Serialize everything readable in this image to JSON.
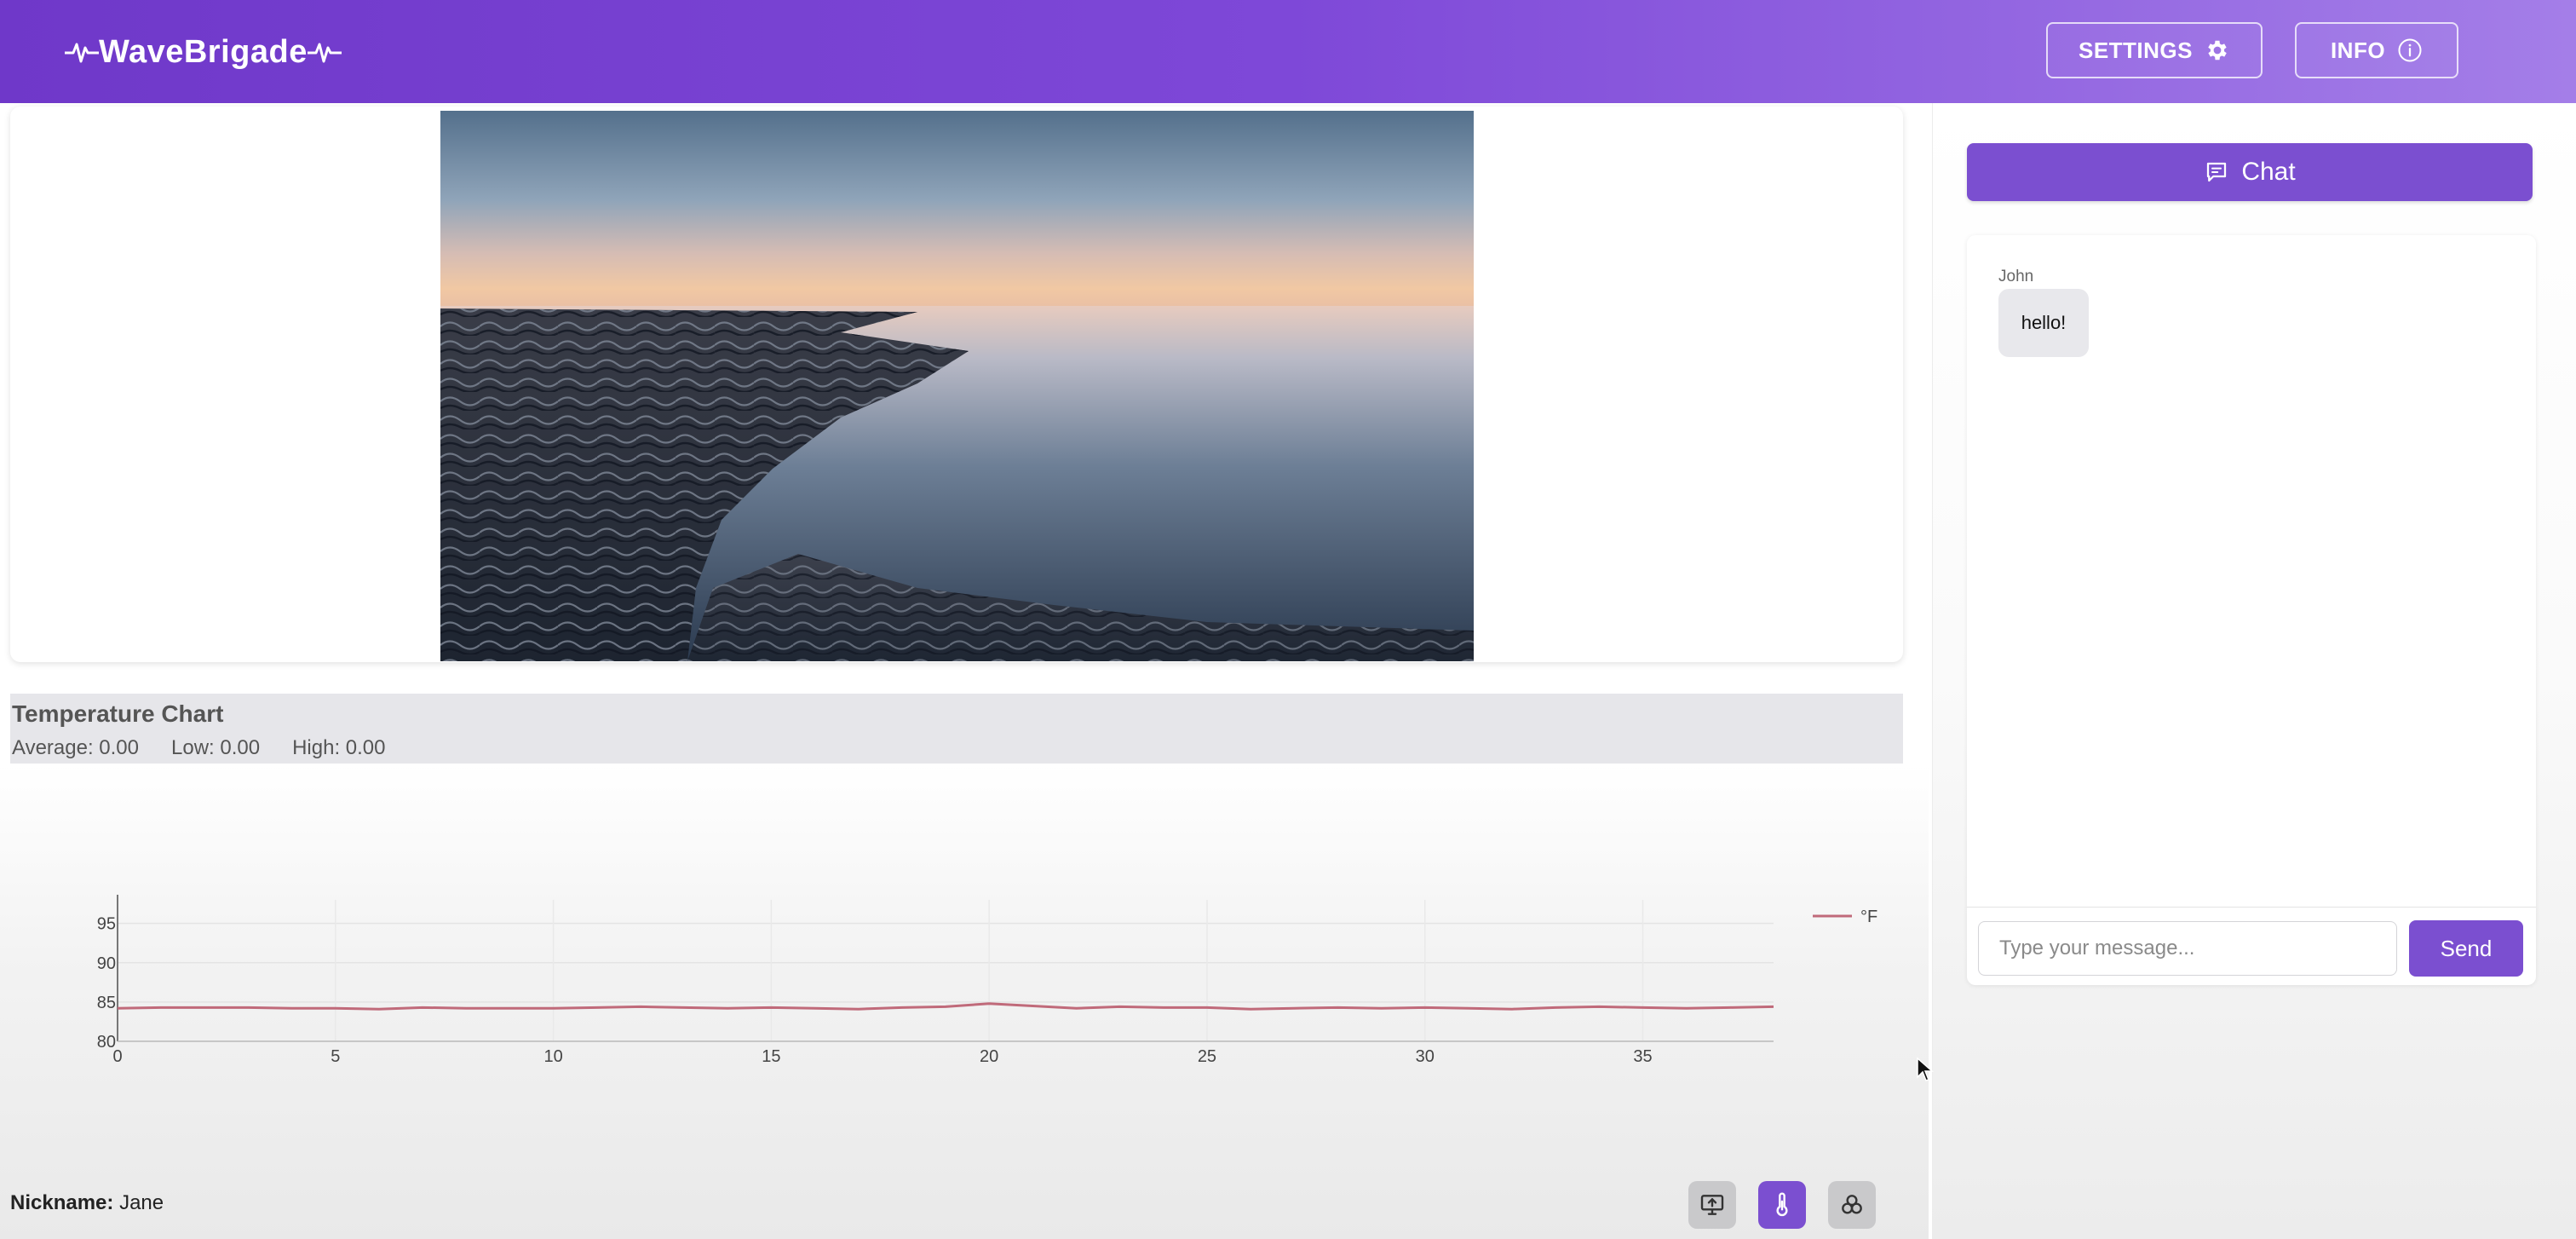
{
  "header": {
    "app_name": "WaveBrigade",
    "settings_label": "SETTINGS",
    "info_label": "INFO",
    "gradient_start": "#6f38c9",
    "gradient_end": "#a47ee8"
  },
  "temperature": {
    "title": "Temperature Chart",
    "average": "Average: 0.00",
    "low": "Low: 0.00",
    "high": "High: 0.00"
  },
  "chart_data": {
    "type": "line",
    "title": "",
    "xlabel": "",
    "ylabel": "",
    "xlim": [
      0,
      38
    ],
    "ylim": [
      80,
      98
    ],
    "x_ticks": [
      0,
      5,
      10,
      15,
      20,
      25,
      30,
      35
    ],
    "y_ticks": [
      80,
      85,
      90,
      95
    ],
    "grid": true,
    "legend_position": "top-right",
    "series": [
      {
        "name": "°F",
        "color": "#c06a7a",
        "x": [
          0,
          1,
          2,
          3,
          4,
          5,
          6,
          7,
          8,
          9,
          10,
          11,
          12,
          13,
          14,
          15,
          16,
          17,
          18,
          19,
          20,
          21,
          22,
          23,
          24,
          25,
          26,
          27,
          28,
          29,
          30,
          31,
          32,
          33,
          34,
          35,
          36,
          37,
          38
        ],
        "values": [
          84.2,
          84.3,
          84.3,
          84.3,
          84.2,
          84.2,
          84.1,
          84.3,
          84.2,
          84.2,
          84.2,
          84.3,
          84.4,
          84.3,
          84.2,
          84.3,
          84.2,
          84.1,
          84.3,
          84.4,
          84.8,
          84.5,
          84.2,
          84.4,
          84.3,
          84.3,
          84.1,
          84.2,
          84.3,
          84.2,
          84.3,
          84.2,
          84.1,
          84.3,
          84.4,
          84.3,
          84.2,
          84.3,
          84.4
        ]
      }
    ]
  },
  "footer": {
    "nickname_label": "Nickname:",
    "nickname_value": "Jane"
  },
  "tools": {
    "accent": "#7b4fd0",
    "icons": [
      "monitor-upload-icon",
      "thermometer-icon",
      "three-circles-icon"
    ]
  },
  "chat": {
    "button_label": "Chat",
    "messages": [
      {
        "author": "John",
        "text": "hello!"
      }
    ],
    "input_placeholder": "Type your message...",
    "send_label": "Send"
  }
}
